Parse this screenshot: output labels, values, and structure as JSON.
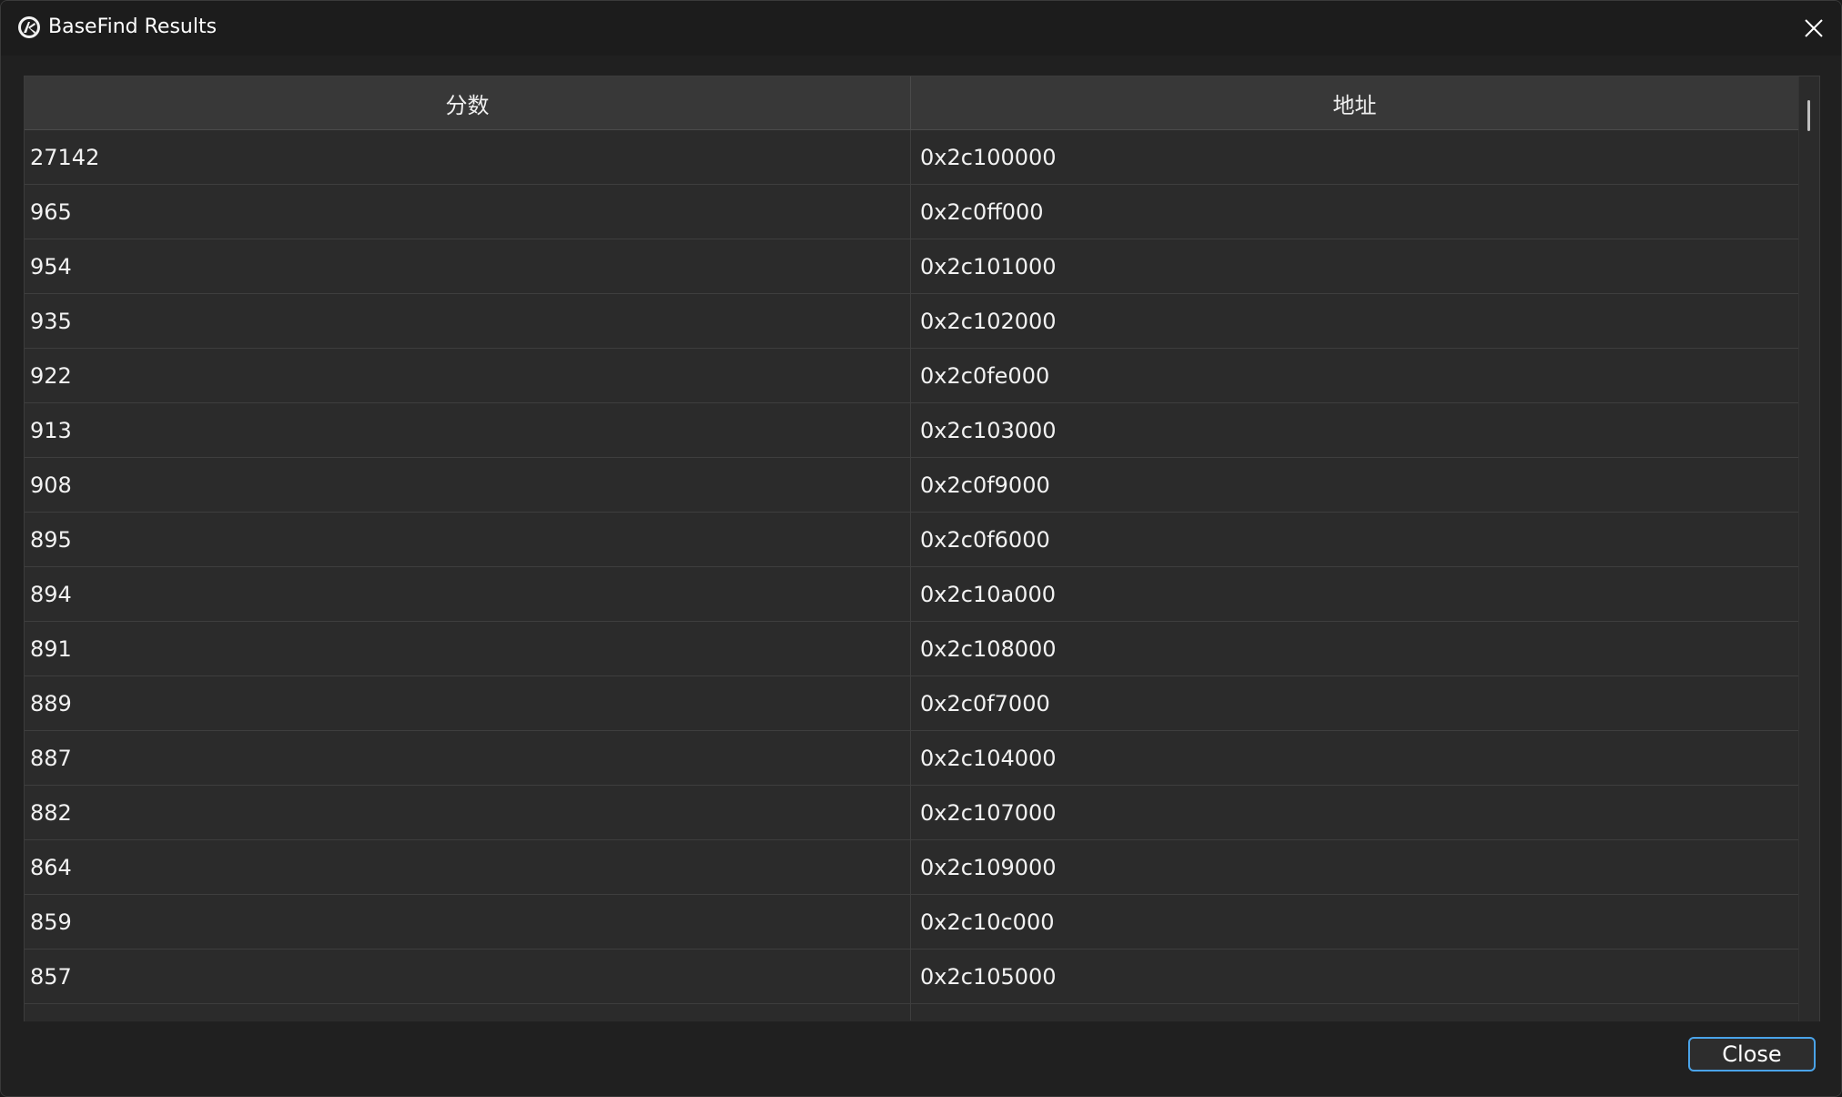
{
  "window": {
    "title": "BaseFind Results",
    "icon": "app-logo-icon",
    "close_icon": "close-icon"
  },
  "table": {
    "columns": [
      "分数",
      "地址"
    ],
    "rows": [
      {
        "score": "27142",
        "address": "0x2c100000"
      },
      {
        "score": "965",
        "address": "0x2c0ff000"
      },
      {
        "score": "954",
        "address": "0x2c101000"
      },
      {
        "score": "935",
        "address": "0x2c102000"
      },
      {
        "score": "922",
        "address": "0x2c0fe000"
      },
      {
        "score": "913",
        "address": "0x2c103000"
      },
      {
        "score": "908",
        "address": "0x2c0f9000"
      },
      {
        "score": "895",
        "address": "0x2c0f6000"
      },
      {
        "score": "894",
        "address": "0x2c10a000"
      },
      {
        "score": "891",
        "address": "0x2c108000"
      },
      {
        "score": "889",
        "address": "0x2c0f7000"
      },
      {
        "score": "887",
        "address": "0x2c104000"
      },
      {
        "score": "882",
        "address": "0x2c107000"
      },
      {
        "score": "864",
        "address": "0x2c109000"
      },
      {
        "score": "859",
        "address": "0x2c10c000"
      },
      {
        "score": "857",
        "address": "0x2c105000"
      },
      {
        "score": "",
        "address": ""
      }
    ]
  },
  "footer": {
    "close_label": "Close"
  },
  "colors": {
    "accent": "#4aa3e8",
    "background": "#202020",
    "table_bg": "#2b2b2b",
    "header_bg": "#383838"
  }
}
